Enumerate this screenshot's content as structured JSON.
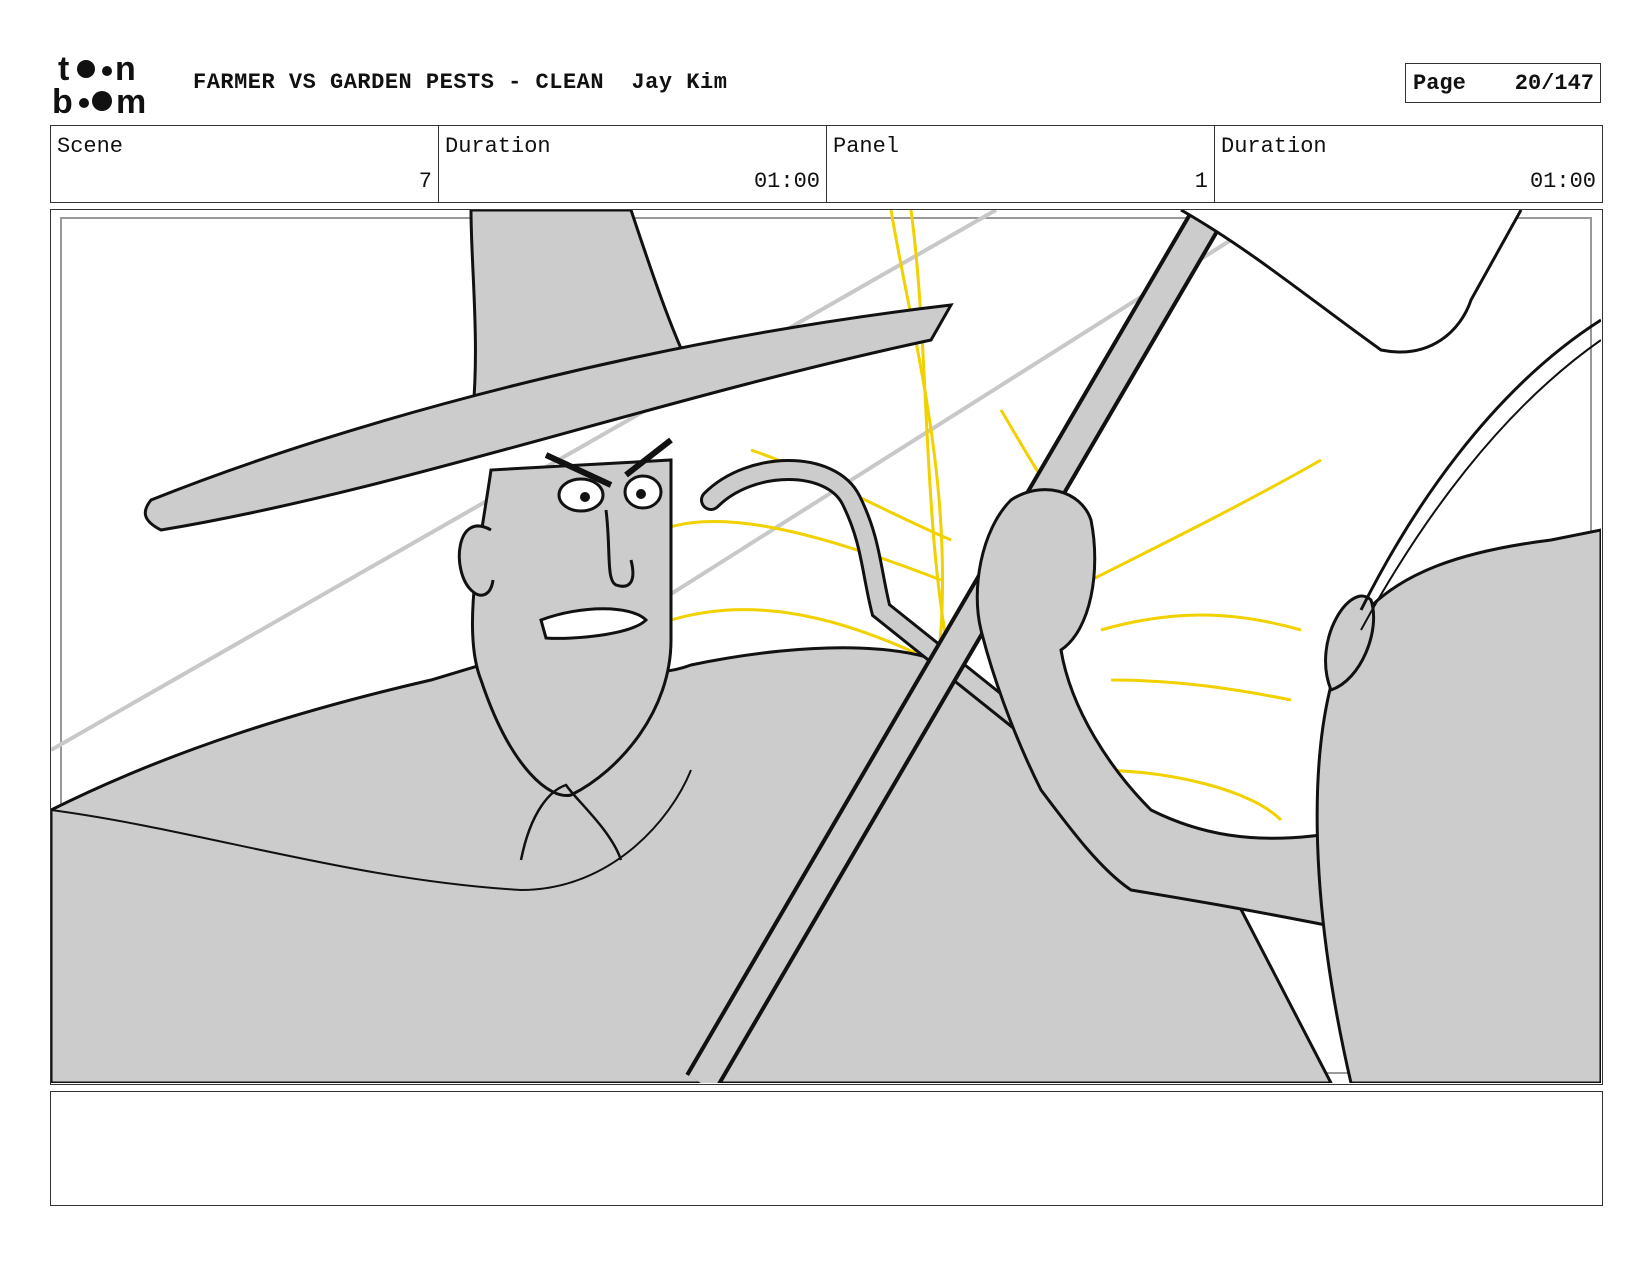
{
  "header": {
    "logo_text": "toon boom",
    "project_title": "FARMER VS GARDEN PESTS - CLEAN",
    "author": "Jay Kim",
    "page_label": "Page",
    "page_value": "20/147"
  },
  "info": {
    "scene_label": "Scene",
    "scene_value": "7",
    "scene_duration_label": "Duration",
    "scene_duration_value": "01:00",
    "panel_label": "Panel",
    "panel_value": "1",
    "panel_duration_label": "Duration",
    "panel_duration_value": "01:00"
  },
  "panel_image": {
    "icon": "storyboard-sketch",
    "colors": {
      "fill": "#cccccc",
      "line": "#111111",
      "impact": "#f2d100"
    }
  },
  "notes": {
    "text": ""
  }
}
